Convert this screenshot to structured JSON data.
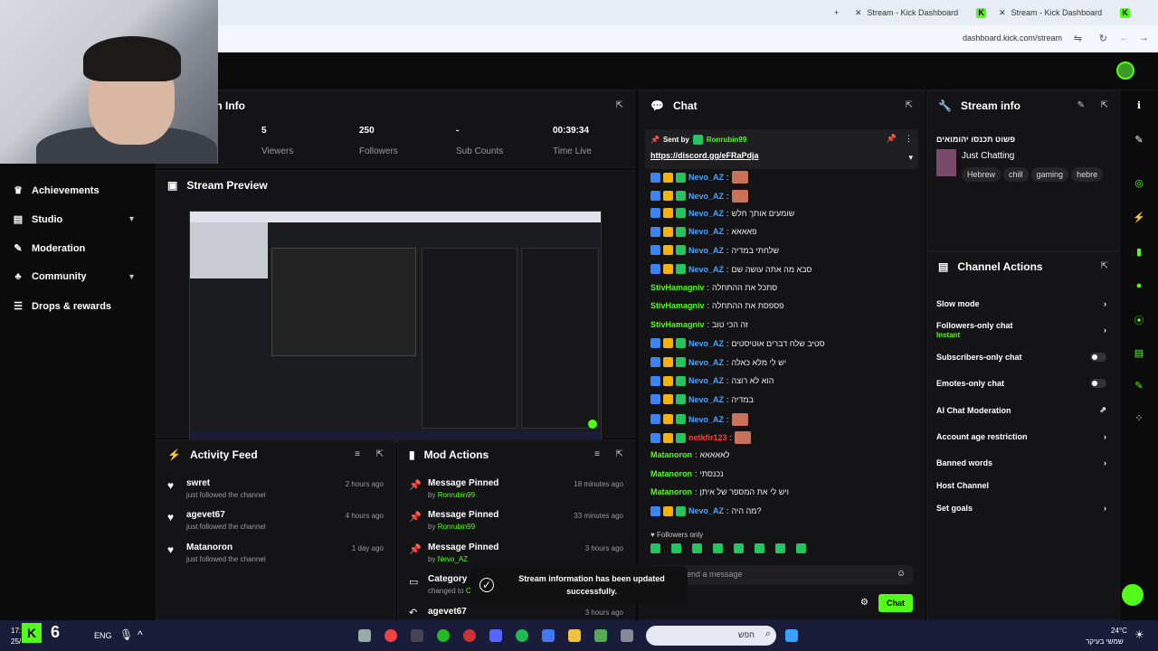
{
  "browser": {
    "tab1": "Stream - Kick Dashboard",
    "tab2": "Stream - Kick Dashboard",
    "new_tab": "+",
    "url": "dashboard.kick.com/stream"
  },
  "sidebar": {
    "items": [
      {
        "label": "Achievements",
        "icon": "trophy-icon"
      },
      {
        "label": "Studio",
        "icon": "studio-icon"
      },
      {
        "label": "Moderation",
        "icon": "wrench-icon"
      },
      {
        "label": "Community",
        "icon": "community-icon"
      },
      {
        "label": "Drops & rewards",
        "icon": "drops-icon"
      }
    ]
  },
  "session": {
    "title": "on Info",
    "stats": [
      {
        "value": "5",
        "label": "Viewers"
      },
      {
        "value": "250",
        "label": "Followers"
      },
      {
        "value": "-",
        "label": "Sub Counts"
      },
      {
        "value": "00:39:34",
        "label": "Time Live"
      }
    ]
  },
  "preview": {
    "title": "Stream Preview"
  },
  "activity": {
    "title": "Activity Feed",
    "items": [
      {
        "name": "swret",
        "desc": "just followed the channel",
        "time": "2 hours ago"
      },
      {
        "name": "agevet67",
        "desc": "just followed the channel",
        "time": "4 hours ago"
      },
      {
        "name": "Matanoron",
        "desc": "just followed the channel",
        "time": "1 day ago"
      }
    ]
  },
  "mod": {
    "title": "Mod Actions",
    "items": [
      {
        "action": "Message Pinned",
        "by": "by",
        "user": "Ronrubin99",
        "time": "18 minutes ago"
      },
      {
        "action": "Message Pinned",
        "by": "by",
        "user": "Ronrubin99",
        "time": "33 minutes ago"
      },
      {
        "action": "Message Pinned",
        "by": "by",
        "user": "Nevo_AZ",
        "time": "3 hours ago"
      },
      {
        "action": "Category",
        "by": "changed to",
        "user": "C",
        "time": ""
      },
      {
        "action": "agevet67",
        "by": "",
        "user": "",
        "time": "3 hours ago"
      }
    ]
  },
  "chat": {
    "title": "Chat",
    "pinned_label": "Sent by",
    "pinned_user": "Ronrubin99",
    "pinned_link": "https://discord.gg/eFRaPdja",
    "messages": [
      {
        "user": "Nevo_AZ",
        "text": "",
        "emote": true,
        "color": "blue"
      },
      {
        "user": "Nevo_AZ",
        "text": "",
        "emote": true,
        "color": "blue"
      },
      {
        "user": "Nevo_AZ",
        "text": "שומעים אותך חלש",
        "emote": false,
        "color": "blue"
      },
      {
        "user": "Nevo_AZ",
        "text": "פאאאא",
        "emote": false,
        "color": "blue"
      },
      {
        "user": "Nevo_AZ",
        "text": "שלחתי במדיה",
        "emote": false,
        "color": "blue"
      },
      {
        "user": "Nevo_AZ",
        "text": "סבא מה אתה עושה שם",
        "emote": false,
        "color": "blue"
      },
      {
        "user": "StivHamagniv",
        "text": "סתכל את ההתחלה",
        "emote": false,
        "color": "green"
      },
      {
        "user": "StivHamagniv",
        "text": "פספסת את ההתחלה",
        "emote": false,
        "color": "green"
      },
      {
        "user": "StivHamagniv",
        "text": "זה הכי טוב",
        "emote": false,
        "color": "green"
      },
      {
        "user": "Nevo_AZ",
        "text": "סטיב שלח דברים אוטיסטים",
        "emote": false,
        "color": "blue"
      },
      {
        "user": "Nevo_AZ",
        "text": "יש לי מלא כאלה",
        "emote": false,
        "color": "blue"
      },
      {
        "user": "Nevo_AZ",
        "text": "הוא לא רוצה",
        "emote": false,
        "color": "blue"
      },
      {
        "user": "Nevo_AZ",
        "text": "במדיה",
        "emote": false,
        "color": "blue"
      },
      {
        "user": "Nevo_AZ",
        "text": "",
        "emote": true,
        "color": "blue"
      },
      {
        "user": "netkfir123",
        "text": "",
        "emote": true,
        "color": "red"
      },
      {
        "user": "Matanoron",
        "text": "לאאאאא",
        "emote": false,
        "color": "green"
      },
      {
        "user": "Matanoron",
        "text": "נכנסתי",
        "emote": false,
        "color": "green"
      },
      {
        "user": "Matanoron",
        "text": "ויש לי את המספר של איתן",
        "emote": false,
        "color": "green"
      },
      {
        "user": "Nevo_AZ",
        "text": "מה היה?",
        "emote": false,
        "color": "blue"
      }
    ],
    "followers_only": "Followers only",
    "input_placeholder": "end a message",
    "send_label": "Chat"
  },
  "stream_info": {
    "title": "Stream info",
    "stream_title": "פשוט תכנסו יהומואים",
    "category": "Just Chatting",
    "tags": [
      "Hebrew",
      "chill",
      "gaming",
      "hebre"
    ]
  },
  "channel_actions": {
    "title": "Channel Actions",
    "items": [
      {
        "label": "Slow mode",
        "control": "chevron"
      },
      {
        "label": "Followers-only chat",
        "sub": "Instant",
        "control": "chevron"
      },
      {
        "label": "Subscribers-only chat",
        "control": "toggle"
      },
      {
        "label": "Emotes-only chat",
        "control": "toggle"
      },
      {
        "label": "AI Chat Moderation",
        "control": "external"
      },
      {
        "label": "Account age restriction",
        "control": "chevron"
      },
      {
        "label": "Banned words",
        "control": "chevron"
      },
      {
        "label": "Host Channel",
        "control": "none"
      },
      {
        "label": "Set goals",
        "control": "chevron"
      }
    ]
  },
  "toast": {
    "message": "Stream information has been updated successfully."
  },
  "taskbar": {
    "lang": "ENG",
    "search_placeholder": "חפש",
    "weather": "24°C",
    "weather_sub": "שמשי בעיקר",
    "time": "17:",
    "date": "25/"
  },
  "colors": {
    "accent": "#53fc18",
    "bg": "#0b0b0c",
    "panel": "#141416"
  }
}
